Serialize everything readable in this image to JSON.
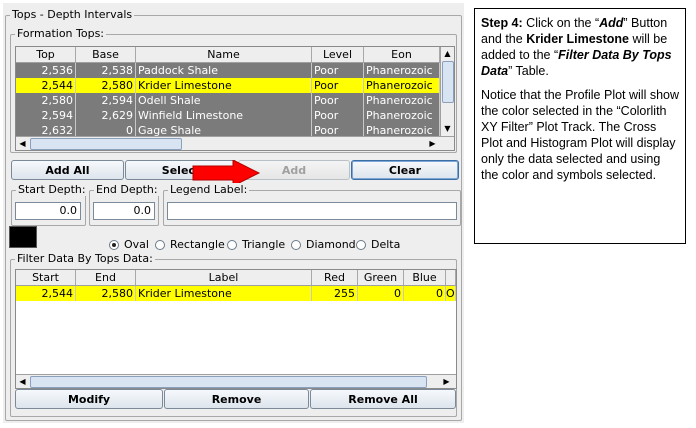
{
  "panel_title": "Tops - Depth Intervals",
  "formation_tops": {
    "title": "Formation Tops:",
    "columns": [
      "Top",
      "Base",
      "Name",
      "Level",
      "Eon"
    ],
    "rows": [
      {
        "top": "2,536",
        "base": "2,538",
        "name": "Paddock Shale",
        "level": "Poor",
        "eon": "Phanerozoic",
        "selected": false
      },
      {
        "top": "2,544",
        "base": "2,580",
        "name": "Krider Limestone",
        "level": "Poor",
        "eon": "Phanerozoic",
        "selected": true
      },
      {
        "top": "2,580",
        "base": "2,594",
        "name": "Odell Shale",
        "level": "Poor",
        "eon": "Phanerozoic",
        "selected": false
      },
      {
        "top": "2,594",
        "base": "2,629",
        "name": "Winfield Limestone",
        "level": "Poor",
        "eon": "Phanerozoic",
        "selected": false
      },
      {
        "top": "2,632",
        "base": "0",
        "name": "Gage Shale",
        "level": "Poor",
        "eon": "Phanerozoic",
        "selected": false
      }
    ]
  },
  "buttons": {
    "add_all": "Add All",
    "select": "Select",
    "add": "Add",
    "clear": "Clear",
    "modify": "Modify",
    "remove": "Remove",
    "remove_all": "Remove All"
  },
  "start_depth": {
    "label": "Start Depth:",
    "value": "0.0"
  },
  "end_depth": {
    "label": "End Depth:",
    "value": "0.0"
  },
  "legend_label": {
    "label": "Legend Label:",
    "value": ""
  },
  "color_swatch": "#000000",
  "symbols": {
    "options": [
      "Oval",
      "Rectangle",
      "Triangle",
      "Diamond",
      "Delta"
    ],
    "selected": "Oval"
  },
  "filter_data": {
    "title": "Filter Data By Tops Data:",
    "columns": [
      "Start",
      "End",
      "Label",
      "Red",
      "Green",
      "Blue",
      ""
    ],
    "rows": [
      {
        "start": "2,544",
        "end": "2,580",
        "label": "Krider Limestone",
        "red": "255",
        "green": "0",
        "blue": "0",
        "extra": "O"
      }
    ]
  },
  "colors": {
    "selected_row": "#ffff00",
    "unselected_row": "#7b7b7b",
    "arrow": "#ff0000"
  },
  "note": {
    "step_label": "Step 4:",
    "p1_a": " Click on the “",
    "p1_add": "Add",
    "p1_b": "” Button and the ",
    "p1_krider": "Krider Limestone",
    "p1_c": " will be added to the “",
    "p1_table": "Filter Data By Tops Data",
    "p1_d": "” Table.",
    "p2": "Notice that the Profile Plot will show the color selected in the “Colorlith XY Filter” Plot Track. The Cross Plot and Histogram Plot will display only the data selected and using the color and symbols selected."
  }
}
